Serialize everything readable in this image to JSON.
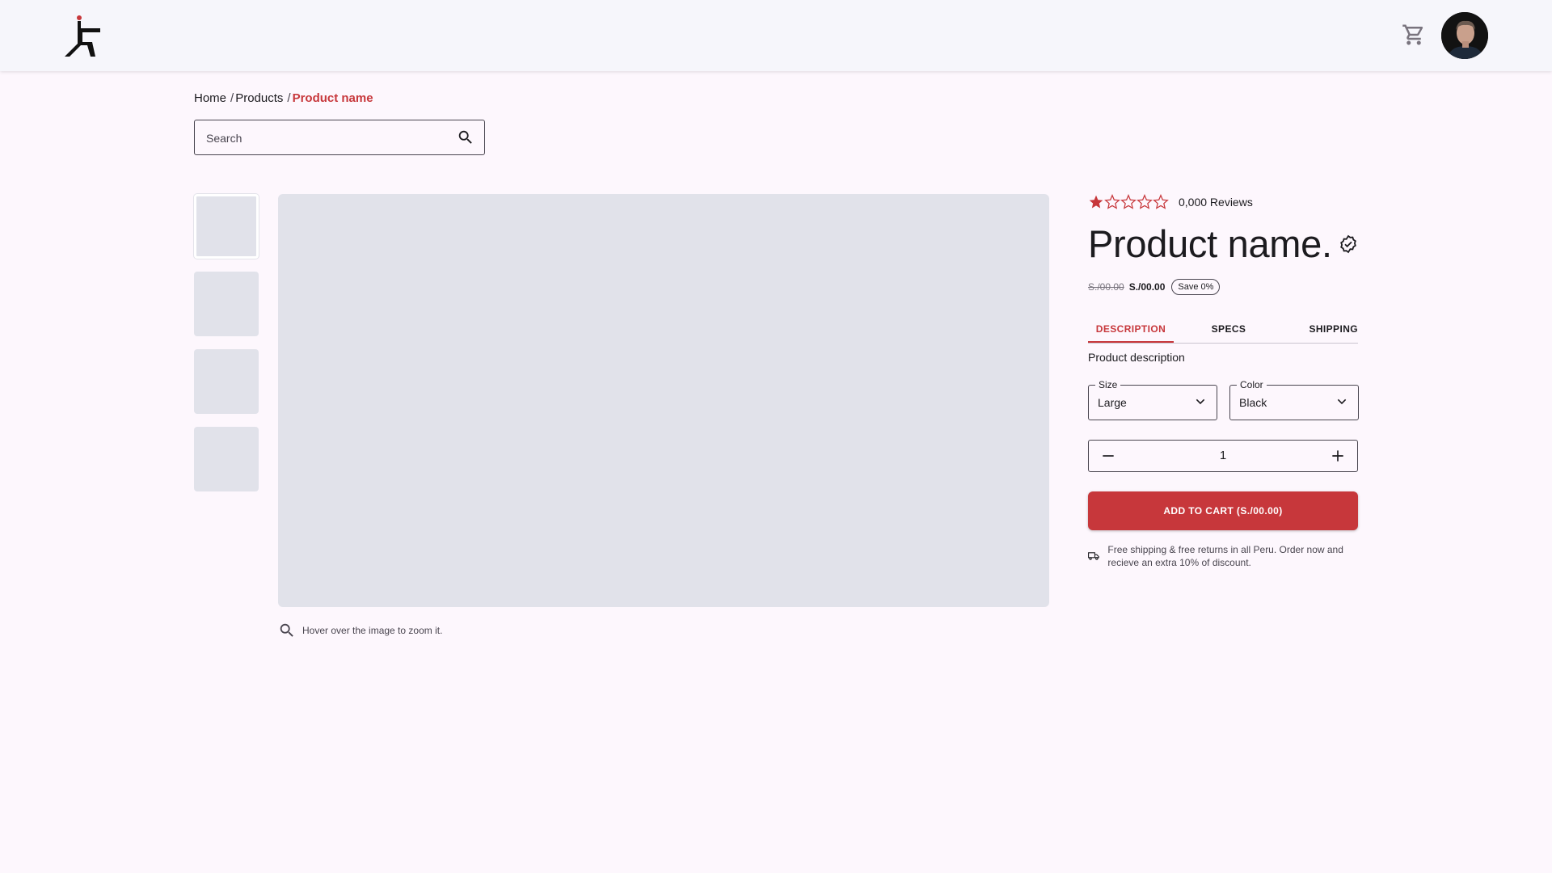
{
  "brand": {
    "accent": "#c7373b"
  },
  "header": {
    "cart_icon": "cart-icon",
    "avatar": "user-avatar"
  },
  "breadcrumb": {
    "items": [
      "Home",
      "Products"
    ],
    "current": "Product name",
    "separator": "/"
  },
  "search": {
    "placeholder": "Search",
    "value": ""
  },
  "gallery": {
    "thumbnails": 4,
    "zoom_hint": "Hover over the image to zoom it."
  },
  "product": {
    "rating": {
      "value": 1,
      "max": 5
    },
    "reviews": "0,000 Reviews",
    "title": "Product name.",
    "old_price": "S./00.00",
    "price": "S./00.00",
    "save_badge": "Save 0%",
    "tabs": [
      "DESCRIPTION",
      "SPECS",
      "SHIPPING"
    ],
    "active_tab": "DESCRIPTION",
    "description": "Product description",
    "size": {
      "label": "Size",
      "value": "Large"
    },
    "color": {
      "label": "Color",
      "value": "Black"
    },
    "quantity": "1",
    "add_to_cart": "ADD TO CART (S./00.00)",
    "shipping_note": "Free shipping & free returns in all Peru. Order now and recieve an extra 10% of discount."
  }
}
